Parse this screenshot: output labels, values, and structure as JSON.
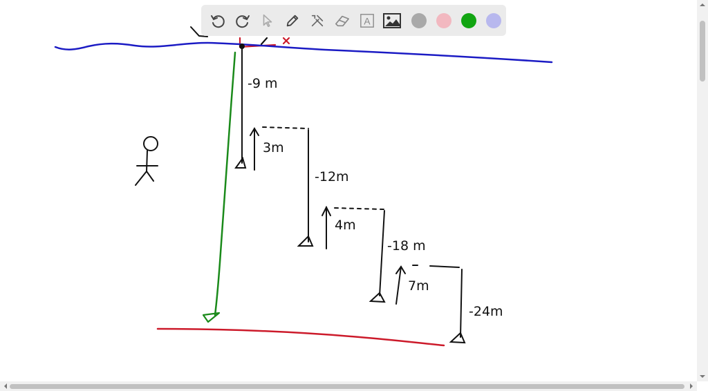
{
  "toolbar": {
    "tools": [
      {
        "name": "undo-icon"
      },
      {
        "name": "redo-icon"
      },
      {
        "name": "select-pointer-icon"
      },
      {
        "name": "pen-icon"
      },
      {
        "name": "tools-icon"
      },
      {
        "name": "eraser-icon"
      },
      {
        "name": "text-icon",
        "glyph": "A"
      },
      {
        "name": "image-icon"
      }
    ],
    "colors": {
      "gray": "#a9a9a9",
      "pink": "#f2b8c0",
      "green": "#12a512",
      "lavender": "#b8b8ee"
    }
  },
  "drawing": {
    "labels": {
      "first_descent": "-9 m",
      "first_ascent": "3m",
      "second_descent": "-12m",
      "second_ascent": "4m",
      "third_descent": "-18 m",
      "third_ascent": "7m",
      "fourth_descent": "-24m"
    },
    "colors": {
      "water_surface": "#1b1bc4",
      "sea_floor": "#cc1a2a",
      "total_path": "#1a8a1a",
      "marker": "#cc1a2a",
      "ink": "#111111"
    }
  }
}
